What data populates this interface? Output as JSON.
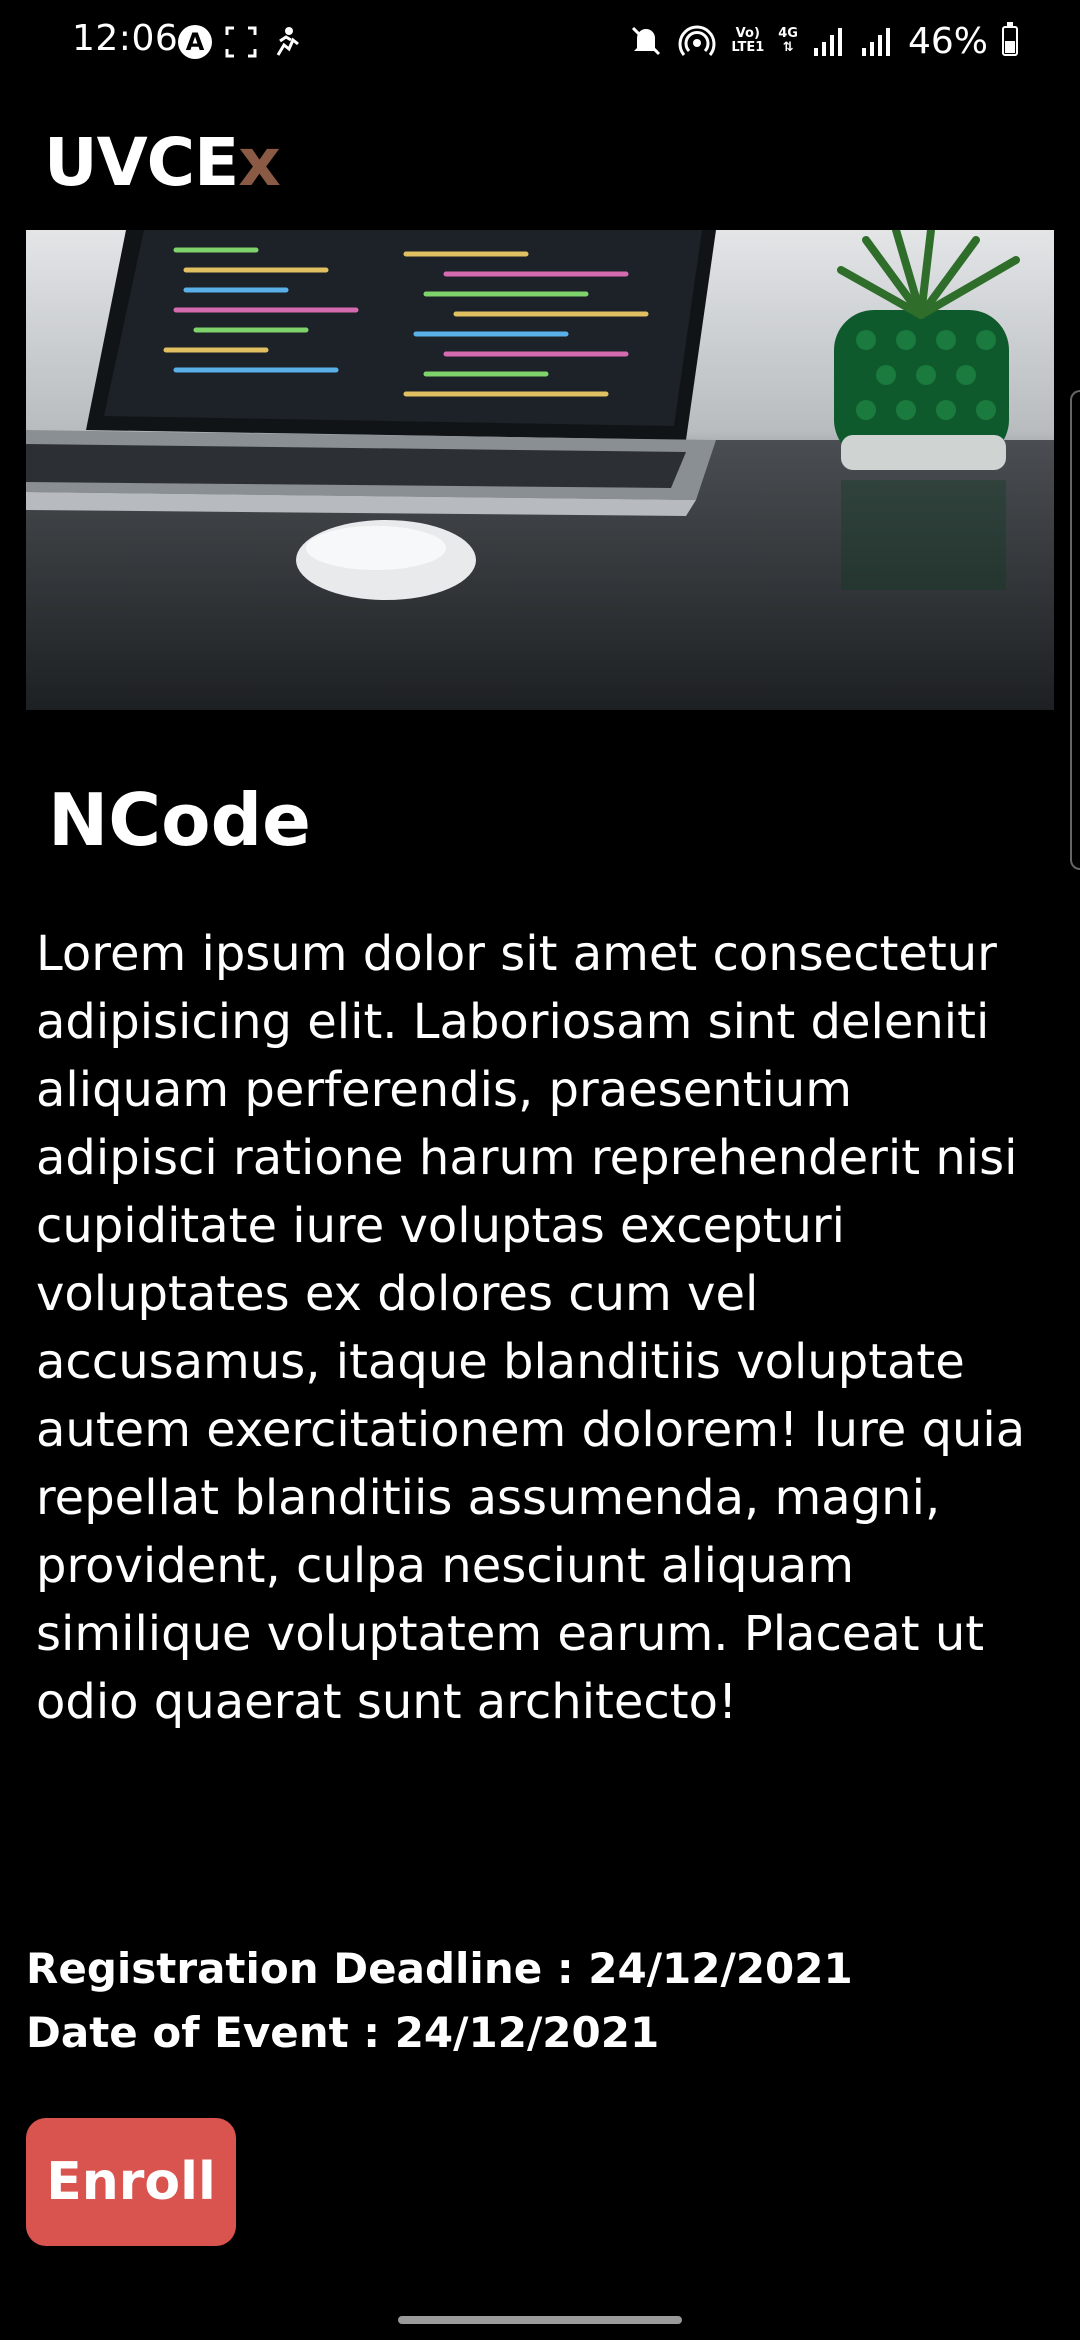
{
  "status_bar": {
    "time": "12:06",
    "battery": "46%",
    "battery_level": 0.46,
    "network_type_top": "Vo)",
    "network_type_bottom": "LTE1",
    "data_top": "4G",
    "icons": [
      "a-badge-icon",
      "screenshot-icon",
      "fitness-icon",
      "mute-icon",
      "hotspot-icon",
      "signal-icon",
      "signal-icon",
      "battery-icon"
    ]
  },
  "app": {
    "title_main": "UVCE",
    "title_accent": "x",
    "accent_color": "#8a5a44"
  },
  "event": {
    "title": "NCode",
    "description": "Lorem ipsum dolor sit amet consectetur adipisicing elit. Laboriosam sint deleniti aliquam perferendis, praesentium adipisci ratione harum reprehenderit nisi cupiditate iure voluptas excepturi voluptates ex dolores cum vel accusamus, itaque blanditiis voluptate autem exercitationem dolorem! Iure quia repellat blanditiis assumenda, magni, provident, culpa nesciunt aliquam similique voluptatem earum. Placeat ut odio quaerat sunt architecto!",
    "registration_deadline": "Registration Deadline : 24/12/2021",
    "event_date": "Date of Event : 24/12/2021",
    "enroll_label": "Enroll",
    "enroll_color": "#d9534f"
  }
}
